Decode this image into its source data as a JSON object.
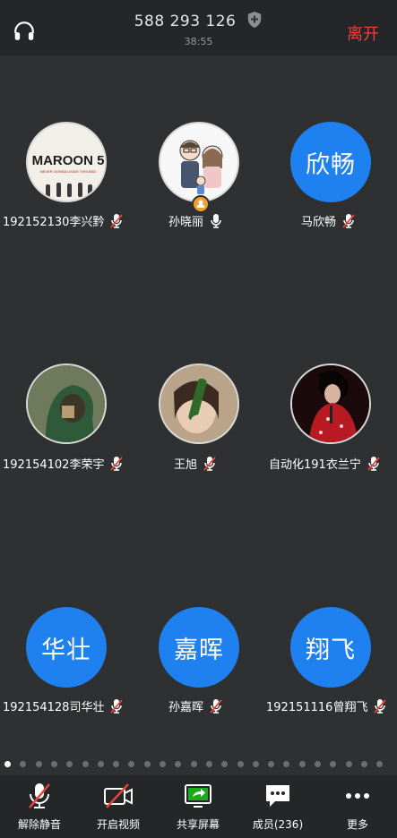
{
  "header": {
    "meeting_id": "588 293 126",
    "timer": "38:55",
    "leave_label": "离开"
  },
  "participants": [
    {
      "name": "192152130李兴黔",
      "avatar_type": "image",
      "avatar_desc": "Maroon 5 album art",
      "muted": true
    },
    {
      "name": "孙晓丽",
      "avatar_type": "image",
      "avatar_desc": "cartoon couple",
      "muted": false,
      "host": true
    },
    {
      "name": "马欣畅",
      "avatar_type": "text",
      "avatar_text": "欣畅",
      "muted": true
    },
    {
      "name": "192154102李荣宇",
      "avatar_type": "image",
      "avatar_desc": "person in green hood",
      "muted": true
    },
    {
      "name": "王旭",
      "avatar_type": "image",
      "avatar_desc": "person with bottle",
      "muted": true
    },
    {
      "name": "自动化191衣兰宁",
      "avatar_type": "image",
      "avatar_desc": "singer in red",
      "muted": true
    },
    {
      "name": "192154128司华壮",
      "avatar_type": "text",
      "avatar_text": "华壮",
      "muted": true
    },
    {
      "name": "孙嘉晖",
      "avatar_type": "text",
      "avatar_text": "嘉晖",
      "muted": true
    },
    {
      "name": "192151116曾翔飞",
      "avatar_type": "text",
      "avatar_text": "翔飞",
      "muted": true
    }
  ],
  "pagination": {
    "total_pages": 25,
    "current_page": 1
  },
  "toolbar": {
    "unmute_label": "解除静音",
    "start_video_label": "开启视频",
    "share_screen_label": "共享屏幕",
    "members_label": "成员(236)",
    "more_label": "更多"
  },
  "colors": {
    "background": "#2e3032",
    "bar": "#242628",
    "accent_blue": "#1f80f0",
    "leave_red": "#e8443a",
    "mute_red": "#e8443a",
    "share_green": "#1aad19"
  },
  "avatar_art": {
    "maroon_logo": "MAROON 5",
    "maroon_subtitle": "NEVER GONNA LEAVE THIS BED"
  }
}
